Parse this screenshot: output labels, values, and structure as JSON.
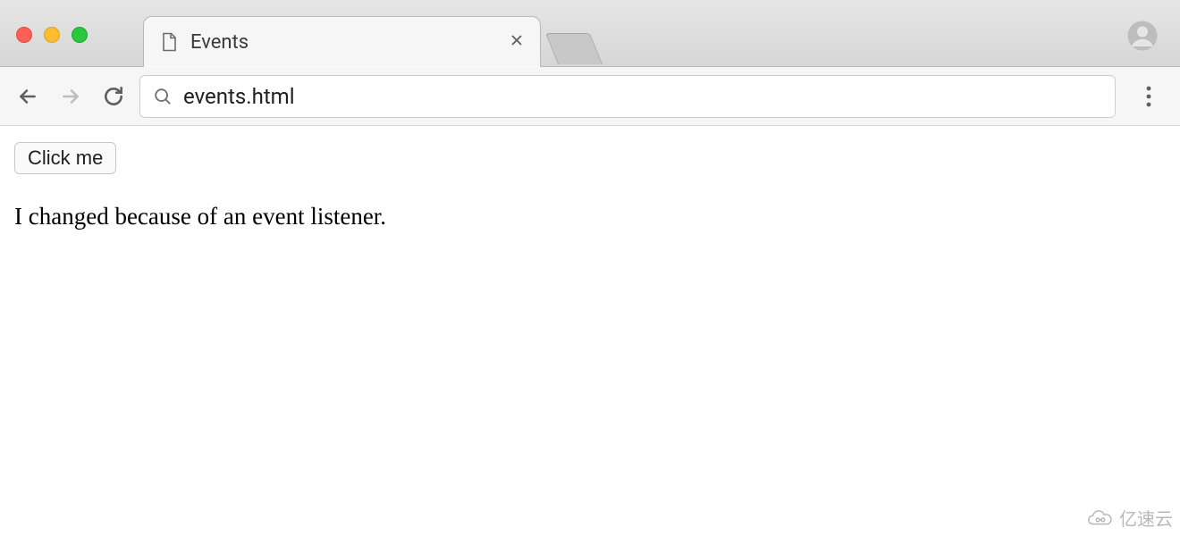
{
  "tab": {
    "title": "Events"
  },
  "omnibox": {
    "url": "events.html"
  },
  "page": {
    "button_label": "Click me",
    "paragraph_text": "I changed because of an event listener."
  },
  "watermark": {
    "text": "亿速云"
  }
}
